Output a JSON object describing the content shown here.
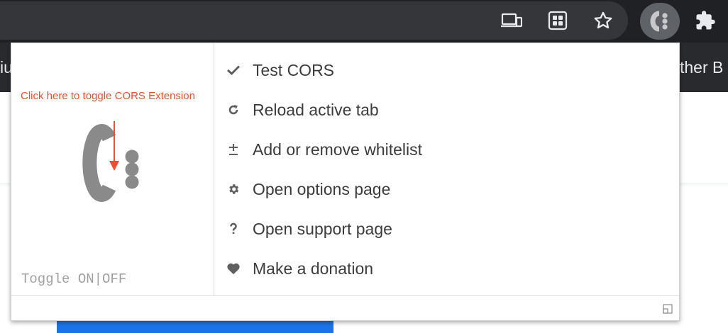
{
  "browser": {
    "bookmarks_bar": {
      "left_fragment": "iu",
      "right_fragment": "ther B"
    },
    "toolbar_icons": [
      "cast-icon",
      "tab-search-icon",
      "star-icon",
      "cors-extension-icon",
      "puzzle-icon"
    ]
  },
  "popup": {
    "hint": "Click here to toggle CORS Extension",
    "toggle_label": {
      "on": "Toggle ON",
      "separator": "|",
      "off": "OFF"
    },
    "menu": [
      {
        "icon": "check-icon",
        "label": "Test CORS"
      },
      {
        "icon": "reload-icon",
        "label": "Reload active tab"
      },
      {
        "icon": "plus-minus-icon",
        "label": "Add or remove whitelist"
      },
      {
        "icon": "gear-icon",
        "label": "Open options page"
      },
      {
        "icon": "question-icon",
        "label": "Open support page"
      },
      {
        "icon": "heart-icon",
        "label": "Make a donation"
      }
    ]
  },
  "colors": {
    "toolbar": "#202124",
    "hint_accent": "#e8502f",
    "logo_gray": "#8a8a8a"
  }
}
